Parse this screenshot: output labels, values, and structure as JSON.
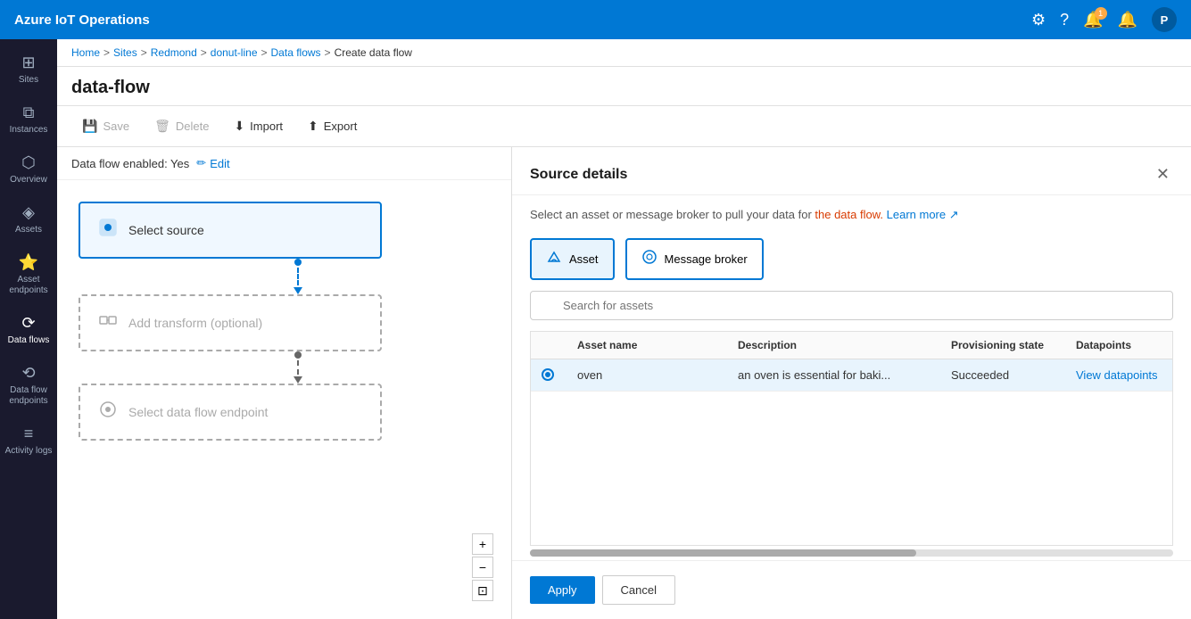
{
  "app": {
    "title": "Azure IoT Operations"
  },
  "topnav": {
    "title": "Azure IoT Operations",
    "avatar_label": "P",
    "notification_count": "1"
  },
  "sidebar": {
    "items": [
      {
        "id": "sites",
        "label": "Sites",
        "icon": "⊞",
        "active": false
      },
      {
        "id": "instances",
        "label": "Instances",
        "icon": "⧉",
        "active": false
      },
      {
        "id": "overview",
        "label": "Overview",
        "icon": "⬡",
        "active": false
      },
      {
        "id": "assets",
        "label": "Assets",
        "icon": "◈",
        "active": false
      },
      {
        "id": "asset-endpoints",
        "label": "Asset endpoints",
        "icon": "⭐",
        "active": false
      },
      {
        "id": "data-flows",
        "label": "Data flows",
        "icon": "⟳",
        "active": true
      },
      {
        "id": "data-flow-endpoints",
        "label": "Data flow endpoints",
        "icon": "⟲",
        "active": false
      },
      {
        "id": "activity-logs",
        "label": "Activity logs",
        "icon": "≡",
        "active": false
      }
    ]
  },
  "breadcrumb": {
    "items": [
      "Home",
      "Sites",
      "Redmond",
      "donut-line",
      "Data flows",
      "Create data flow"
    ]
  },
  "page": {
    "title": "data-flow"
  },
  "toolbar": {
    "save_label": "Save",
    "delete_label": "Delete",
    "import_label": "Import",
    "export_label": "Export"
  },
  "dataflow": {
    "enabled_text": "Data flow enabled: Yes",
    "edit_label": "Edit",
    "nodes": [
      {
        "id": "source",
        "label": "Select source",
        "icon": "⬡",
        "type": "solid"
      },
      {
        "id": "transform",
        "label": "Add transform (optional)",
        "icon": "⊞",
        "type": "dashed"
      },
      {
        "id": "endpoint",
        "label": "Select data flow endpoint",
        "icon": "⟲",
        "type": "dashed"
      }
    ]
  },
  "source_details": {
    "title": "Source details",
    "description": "Select an asset or message broker to pull your data for",
    "description_highlight": "the data flow.",
    "learn_more": "Learn more",
    "source_types": [
      {
        "id": "asset",
        "label": "Asset",
        "icon": "↰",
        "selected": true
      },
      {
        "id": "message-broker",
        "label": "Message broker",
        "icon": "⟳",
        "selected": false
      }
    ],
    "search_placeholder": "Search for assets",
    "table": {
      "columns": [
        "",
        "Asset name",
        "Description",
        "Provisioning state",
        "Datapoints"
      ],
      "rows": [
        {
          "selected": true,
          "asset_name": "oven",
          "description": "an oven is essential for baki...",
          "provisioning_state": "Succeeded",
          "datapoints": "View datapoints"
        }
      ]
    },
    "apply_label": "Apply",
    "cancel_label": "Cancel"
  }
}
